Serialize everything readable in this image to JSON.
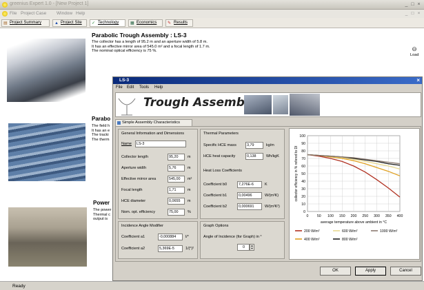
{
  "window": {
    "title": "greenius Expert 1.0 - [New Project 1]",
    "controls": [
      "_",
      "□",
      "×"
    ],
    "inner_controls": [
      "_",
      "□",
      "×"
    ]
  },
  "menubar": [
    "File",
    "Project Case",
    "Window",
    "Help"
  ],
  "tabs": [
    {
      "label": "Project Summary",
      "icon": "clipboard-icon"
    },
    {
      "label": "Project Site",
      "icon": "map-pin-icon"
    },
    {
      "label": "Technology",
      "icon": "check-icon"
    },
    {
      "label": "Economics",
      "icon": "calculator-icon"
    },
    {
      "label": "Results",
      "icon": "results-icon"
    }
  ],
  "sections": [
    {
      "title": "Parabolic Trough Assembly : LS-3",
      "lines": [
        "The collector has a length of 95.2 m and an aperture width of 5.8 m.",
        "It has an effective mirror area of 545.0 m² and a focal length of 1.7 m.",
        "The nominal optical efficiency is 75 %."
      ]
    },
    {
      "title": "Parabo",
      "lines": [
        "The field h",
        "It has an e",
        "The tracki",
        "The therm"
      ]
    },
    {
      "title": "Power",
      "lines": [
        "The power",
        "Thermal c",
        "output is"
      ]
    }
  ],
  "load": {
    "label": "Load",
    "icon": "load-icon"
  },
  "status": "Ready",
  "dialog": {
    "title": "LS-3",
    "menu": [
      "File",
      "Edit",
      "Tools",
      "Help"
    ],
    "banner_title": "Trough Assembly",
    "tab_label": "Simple Assembly Characteristics",
    "general": {
      "title": "General Information and Dimensions",
      "name_label": "Name",
      "name_value": "LS-3",
      "fields": [
        {
          "label": "Collector length",
          "value": "95,20",
          "unit": "m"
        },
        {
          "label": "Aperture width",
          "value": "5,76",
          "unit": "m"
        },
        {
          "label": "Effective mirror area",
          "value": "545,00",
          "unit": "m²"
        },
        {
          "label": "Focal length",
          "value": "1,71",
          "unit": "m"
        },
        {
          "label": "HCE diameter",
          "value": "0,0655",
          "unit": "m"
        },
        {
          "label": "Nom. opt. efficiency",
          "value": "75,00",
          "unit": "%"
        }
      ]
    },
    "thermal": {
      "title": "Thermal Parameters",
      "fields": [
        {
          "label": "Specific HCE mass",
          "value": "3,79",
          "unit": "kg/m"
        },
        {
          "label": "HCE heat capacity",
          "value": "0,138",
          "unit": "Wh/kgK"
        }
      ],
      "heat_loss_title": "Heat Loss Coefficients",
      "coeffs": [
        {
          "label": "Coefficient b0",
          "value": "7,276E-6",
          "unit": "K"
        },
        {
          "label": "Coefficient b1",
          "value": "0,00496",
          "unit": "W/(m²K)"
        },
        {
          "label": "Coefficient b2",
          "value": "0,000691",
          "unit": "W/(m²K²)"
        }
      ]
    },
    "incidence": {
      "title": "Incidence Angle Modifier",
      "coeffs": [
        {
          "label": "Coefficient a1",
          "value": "-0,000884",
          "unit": "l/°"
        },
        {
          "label": "Coefficient a2",
          "value": "5,369E-5",
          "unit": "1/(°)²"
        }
      ]
    },
    "graph_options": {
      "title": "Graph Options",
      "angle_label": "Angle of Incidence (for Graph) in °",
      "angle_value": "0"
    },
    "buttons": [
      "OK",
      "Apply",
      "Cancel"
    ]
  },
  "chart_data": {
    "type": "line",
    "xlabel": "average temperature above ambient in °C",
    "ylabel": "collector efficiency in % refered to DI",
    "xlim": [
      0,
      400
    ],
    "ylim": [
      0,
      100
    ],
    "xticks": [
      0,
      50,
      100,
      150,
      200,
      250,
      300,
      350,
      400
    ],
    "yticks": [
      0,
      10,
      20,
      30,
      40,
      50,
      60,
      70,
      80,
      90,
      100
    ],
    "grid": true,
    "legend_position": "bottom",
    "series": [
      {
        "name": "200 W/m²",
        "color": "#b03020",
        "x": [
          0,
          50,
          100,
          150,
          200,
          250,
          300,
          350,
          400
        ],
        "values": [
          75,
          73,
          70,
          66,
          60,
          52,
          42,
          31,
          19
        ]
      },
      {
        "name": "400 W/m²",
        "color": "#e0a020",
        "x": [
          0,
          50,
          100,
          150,
          200,
          250,
          300,
          350,
          400
        ],
        "values": [
          75,
          74,
          72,
          70,
          67,
          63,
          58,
          53,
          47
        ]
      },
      {
        "name": "600 W/m²",
        "color": "#e8d890",
        "x": [
          0,
          50,
          100,
          150,
          200,
          250,
          300,
          350,
          400
        ],
        "values": [
          75,
          74,
          73,
          71,
          69,
          66,
          63,
          60,
          56
        ]
      },
      {
        "name": "800 W/m²",
        "color": "#202020",
        "x": [
          0,
          50,
          100,
          150,
          200,
          250,
          300,
          350,
          400
        ],
        "values": [
          75,
          74,
          73,
          72,
          70,
          68,
          66,
          63,
          61
        ]
      },
      {
        "name": "1000 W/m²",
        "color": "#8a7a70",
        "x": [
          0,
          50,
          100,
          150,
          200,
          250,
          300,
          350,
          400
        ],
        "values": [
          75,
          74,
          73,
          72,
          71,
          69,
          67,
          65,
          63
        ]
      }
    ]
  }
}
